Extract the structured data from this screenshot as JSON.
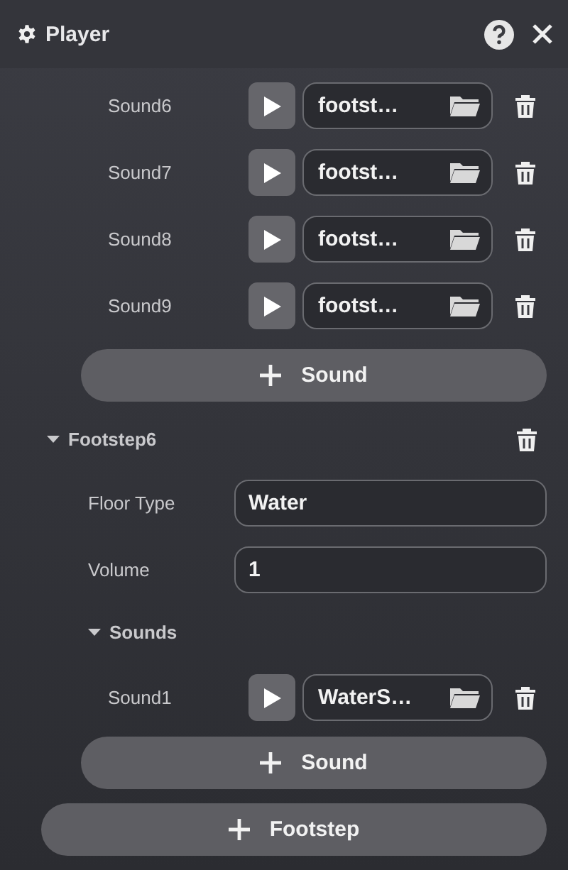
{
  "window": {
    "title": "Player"
  },
  "sound_list": {
    "items": [
      {
        "label": "Sound6",
        "file": "footst…"
      },
      {
        "label": "Sound7",
        "file": "footst…"
      },
      {
        "label": "Sound8",
        "file": "footst…"
      },
      {
        "label": "Sound9",
        "file": "footst…"
      }
    ],
    "add_button": "Sound"
  },
  "footsteps": [
    {
      "title": "Footstep6",
      "expanded": true,
      "fields": [
        {
          "label": "Floor Type",
          "value": "Water"
        },
        {
          "label": "Volume",
          "value": "1"
        }
      ],
      "sounds": {
        "title": "Sounds",
        "expanded": true,
        "items": [
          {
            "label": "Sound1",
            "file": "WaterS…"
          }
        ],
        "add_button": "Sound"
      }
    }
  ],
  "add_footstep_button": "Footstep"
}
